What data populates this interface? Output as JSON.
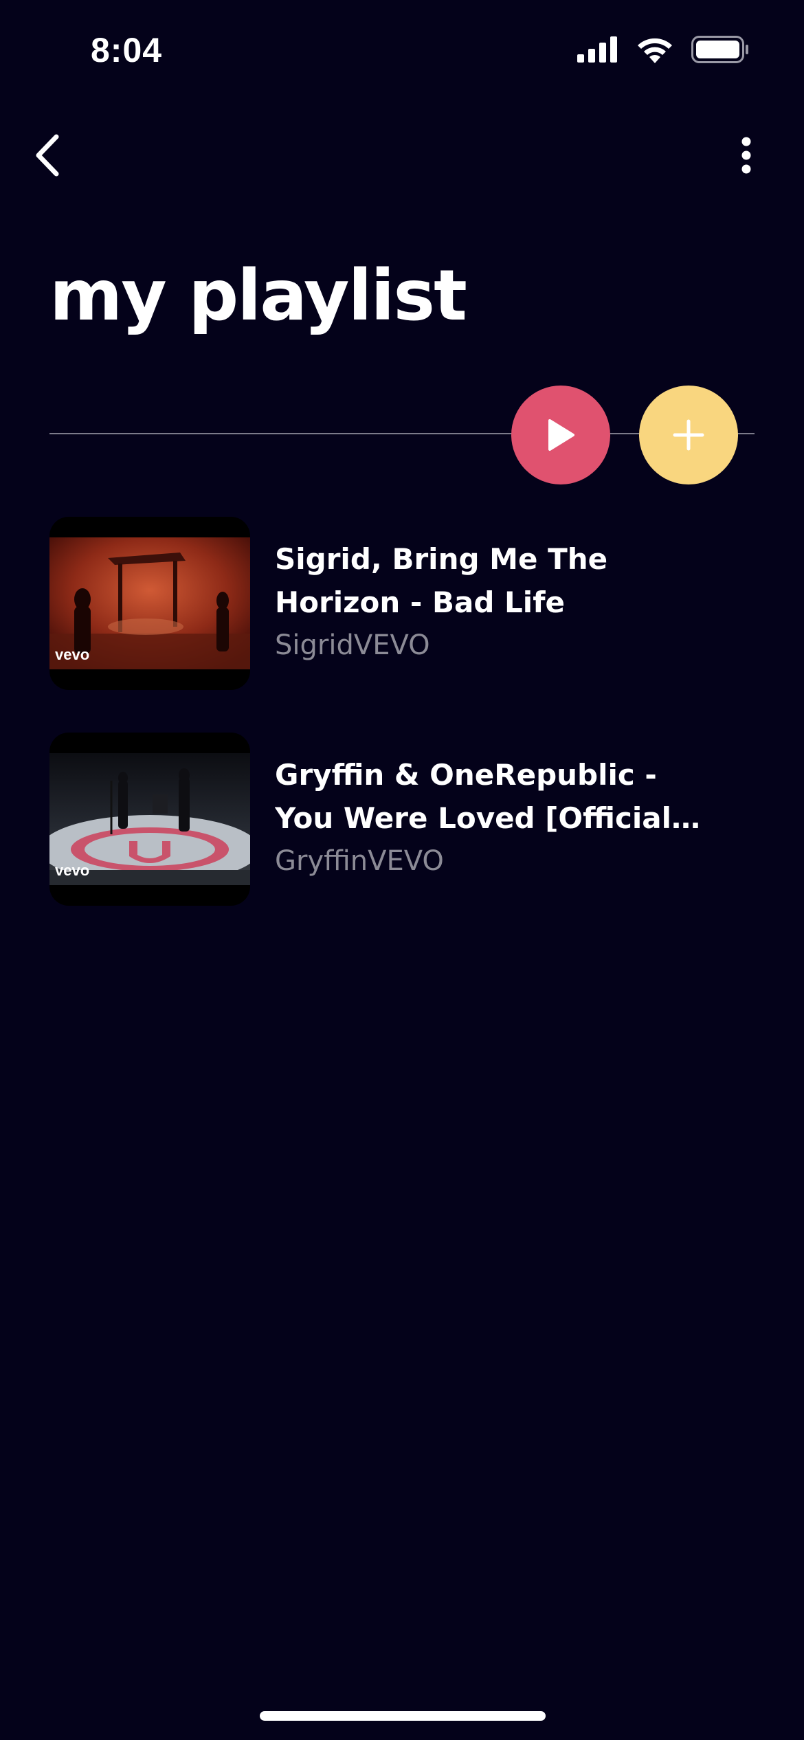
{
  "status_bar": {
    "time": "8:04",
    "icons": [
      "signal-icon",
      "wifi-icon",
      "battery-icon"
    ]
  },
  "nav": {
    "back_icon": "chevron-left-icon",
    "more_icon": "more-vertical-icon"
  },
  "page": {
    "title": "my playlist"
  },
  "actions": {
    "play_icon": "play-icon",
    "play_color": "#e0526f",
    "add_icon": "plus-icon",
    "add_color": "#f9d67f"
  },
  "tracks": [
    {
      "title": "Sigrid, Bring Me The Horizon - Bad Life",
      "artist": "SigridVEVO",
      "thumb_label": "vevo"
    },
    {
      "title": "Gryffin & OneRepublic - You Were Loved [Official Video]",
      "artist": "GryffinVEVO",
      "thumb_label": "vevo"
    }
  ],
  "colors": {
    "background": "#04021a",
    "text_primary": "#ffffff",
    "text_secondary": "#8c8b96"
  }
}
